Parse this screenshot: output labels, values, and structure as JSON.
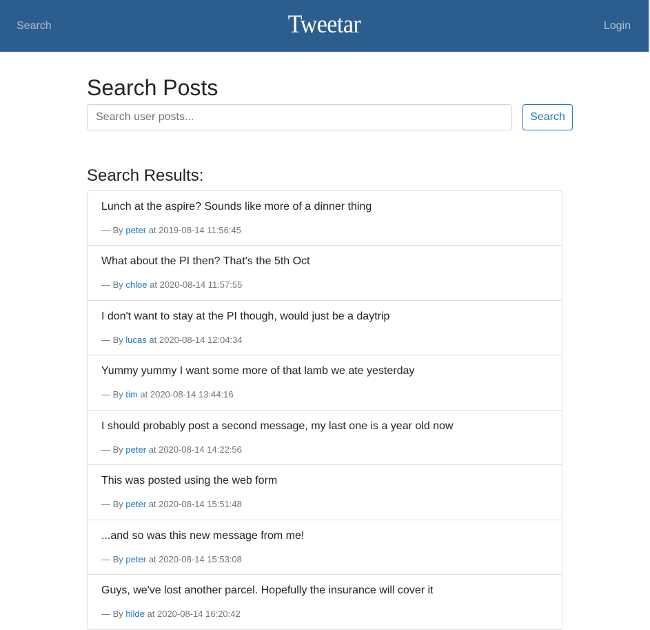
{
  "navbar": {
    "search_link": "Search",
    "brand": "Tweetar",
    "login_link": "Login"
  },
  "main": {
    "title": "Search Posts",
    "search": {
      "placeholder": "Search user posts...",
      "value": "",
      "button_label": "Search"
    },
    "results_heading": "Search Results:",
    "meta_prefix": "— By",
    "meta_at": "at",
    "posts": [
      {
        "text": "Lunch at the aspire? Sounds like more of a dinner thing",
        "author": "peter",
        "timestamp": "2019-08-14 11:56:45"
      },
      {
        "text": "What about the PI then? That's the 5th Oct",
        "author": "chloe",
        "timestamp": "2020-08-14 11:57:55"
      },
      {
        "text": "I don't want to stay at the PI though, would just be a daytrip",
        "author": "lucas",
        "timestamp": "2020-08-14 12:04:34"
      },
      {
        "text": "Yummy yummy I want some more of that lamb we ate yesterday",
        "author": "tim",
        "timestamp": "2020-08-14 13:44:16"
      },
      {
        "text": "I should probably post a second message, my last one is a year old now",
        "author": "peter",
        "timestamp": "2020-08-14 14:22:56"
      },
      {
        "text": "This was posted using the web form",
        "author": "peter",
        "timestamp": "2020-08-14 15:51:48"
      },
      {
        "text": "...and so was this new message from me!",
        "author": "peter",
        "timestamp": "2020-08-14 15:53:08"
      },
      {
        "text": "Guys, we've lost another parcel. Hopefully the insurance will cover it",
        "author": "hilde",
        "timestamp": "2020-08-14 16:20:42"
      }
    ]
  },
  "colors": {
    "navbar_bg": "#2c5d8f",
    "link": "#1a73c8",
    "button_outline": "#2176c7"
  }
}
